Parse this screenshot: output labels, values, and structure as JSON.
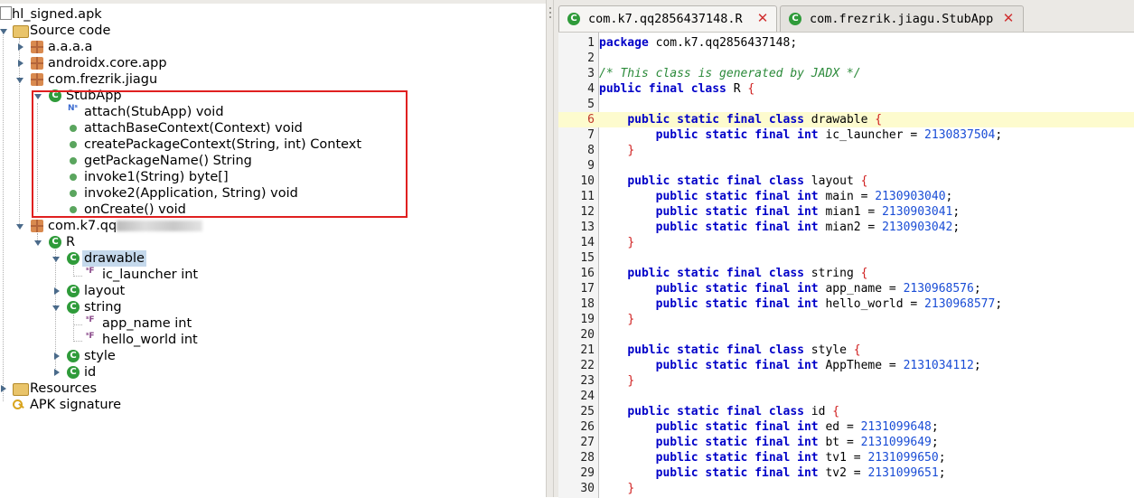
{
  "tree": {
    "root": "hl_signed.apk",
    "source_code": "Source code",
    "packages": [
      "a.a.a.a",
      "androidx.core.app",
      "com.frezrik.jiagu"
    ],
    "stubapp": "StubApp",
    "methods": [
      {
        "label": "attach(StubApp) void",
        "icon": "static-method-icon"
      },
      {
        "label": "attachBaseContext(Context) void",
        "icon": "method-icon"
      },
      {
        "label": "createPackageContext(String, int) Context",
        "icon": "method-icon"
      },
      {
        "label": "getPackageName() String",
        "icon": "method-icon"
      },
      {
        "label": "invoke1(String) byte[]",
        "icon": "method-icon"
      },
      {
        "label": "invoke2(Application, String) void",
        "icon": "method-icon"
      },
      {
        "label": "onCreate() void",
        "icon": "method-icon"
      }
    ],
    "pkg_k7_prefix": "com.k7.qq",
    "class_r": "R",
    "inner_classes": {
      "drawable": "drawable",
      "drawable_fields": [
        "ic_launcher int"
      ],
      "layout": "layout",
      "string": "string",
      "string_fields": [
        "app_name int",
        "hello_world int"
      ],
      "style": "style",
      "id": "id"
    },
    "resources": "Resources",
    "apk_signature": "APK signature"
  },
  "tabs": [
    {
      "label": "com.k7.qq2856437148.R",
      "active": true
    },
    {
      "label": "com.frezrik.jiagu.StubApp",
      "active": false
    }
  ],
  "editor": {
    "current_line": 6,
    "lines": [
      {
        "n": "1",
        "parts": [
          [
            "kw",
            "package"
          ],
          [
            "t",
            " com.k7.qq2856437148;"
          ]
        ]
      },
      {
        "n": "2",
        "parts": []
      },
      {
        "n": "3",
        "parts": [
          [
            "cm",
            "/* This class is generated by JADX */"
          ]
        ]
      },
      {
        "n": "4",
        "parts": [
          [
            "kw",
            "public final class"
          ],
          [
            "t",
            " R "
          ],
          [
            "b",
            "{"
          ]
        ]
      },
      {
        "n": "5",
        "parts": []
      },
      {
        "n": "6",
        "parts": [
          [
            "t",
            "    "
          ],
          [
            "kw",
            "public static final class"
          ],
          [
            "t",
            " drawable "
          ],
          [
            "b",
            "{"
          ]
        ]
      },
      {
        "n": "7",
        "parts": [
          [
            "t",
            "        "
          ],
          [
            "kw",
            "public static final int"
          ],
          [
            "t",
            " ic_launcher = "
          ],
          [
            "num",
            "2130837504"
          ],
          [
            "t",
            ";"
          ]
        ]
      },
      {
        "n": "8",
        "parts": [
          [
            "t",
            "    "
          ],
          [
            "b",
            "}"
          ]
        ]
      },
      {
        "n": "9",
        "parts": []
      },
      {
        "n": "10",
        "parts": [
          [
            "t",
            "    "
          ],
          [
            "kw",
            "public static final class"
          ],
          [
            "t",
            " layout "
          ],
          [
            "b",
            "{"
          ]
        ]
      },
      {
        "n": "11",
        "parts": [
          [
            "t",
            "        "
          ],
          [
            "kw",
            "public static final int"
          ],
          [
            "t",
            " main = "
          ],
          [
            "num",
            "2130903040"
          ],
          [
            "t",
            ";"
          ]
        ]
      },
      {
        "n": "12",
        "parts": [
          [
            "t",
            "        "
          ],
          [
            "kw",
            "public static final int"
          ],
          [
            "t",
            " mian1 = "
          ],
          [
            "num",
            "2130903041"
          ],
          [
            "t",
            ";"
          ]
        ]
      },
      {
        "n": "13",
        "parts": [
          [
            "t",
            "        "
          ],
          [
            "kw",
            "public static final int"
          ],
          [
            "t",
            " mian2 = "
          ],
          [
            "num",
            "2130903042"
          ],
          [
            "t",
            ";"
          ]
        ]
      },
      {
        "n": "14",
        "parts": [
          [
            "t",
            "    "
          ],
          [
            "b",
            "}"
          ]
        ]
      },
      {
        "n": "15",
        "parts": []
      },
      {
        "n": "16",
        "parts": [
          [
            "t",
            "    "
          ],
          [
            "kw",
            "public static final class"
          ],
          [
            "t",
            " string "
          ],
          [
            "b",
            "{"
          ]
        ]
      },
      {
        "n": "17",
        "parts": [
          [
            "t",
            "        "
          ],
          [
            "kw",
            "public static final int"
          ],
          [
            "t",
            " app_name = "
          ],
          [
            "num",
            "2130968576"
          ],
          [
            "t",
            ";"
          ]
        ]
      },
      {
        "n": "18",
        "parts": [
          [
            "t",
            "        "
          ],
          [
            "kw",
            "public static final int"
          ],
          [
            "t",
            " hello_world = "
          ],
          [
            "num",
            "2130968577"
          ],
          [
            "t",
            ";"
          ]
        ]
      },
      {
        "n": "19",
        "parts": [
          [
            "t",
            "    "
          ],
          [
            "b",
            "}"
          ]
        ]
      },
      {
        "n": "20",
        "parts": []
      },
      {
        "n": "21",
        "parts": [
          [
            "t",
            "    "
          ],
          [
            "kw",
            "public static final class"
          ],
          [
            "t",
            " style "
          ],
          [
            "b",
            "{"
          ]
        ]
      },
      {
        "n": "22",
        "parts": [
          [
            "t",
            "        "
          ],
          [
            "kw",
            "public static final int"
          ],
          [
            "t",
            " AppTheme = "
          ],
          [
            "num",
            "2131034112"
          ],
          [
            "t",
            ";"
          ]
        ]
      },
      {
        "n": "23",
        "parts": [
          [
            "t",
            "    "
          ],
          [
            "b",
            "}"
          ]
        ]
      },
      {
        "n": "24",
        "parts": []
      },
      {
        "n": "25",
        "parts": [
          [
            "t",
            "    "
          ],
          [
            "kw",
            "public static final class"
          ],
          [
            "t",
            " id "
          ],
          [
            "b",
            "{"
          ]
        ]
      },
      {
        "n": "26",
        "parts": [
          [
            "t",
            "        "
          ],
          [
            "kw",
            "public static final int"
          ],
          [
            "t",
            " ed = "
          ],
          [
            "num",
            "2131099648"
          ],
          [
            "t",
            ";"
          ]
        ]
      },
      {
        "n": "27",
        "parts": [
          [
            "t",
            "        "
          ],
          [
            "kw",
            "public static final int"
          ],
          [
            "t",
            " bt = "
          ],
          [
            "num",
            "2131099649"
          ],
          [
            "t",
            ";"
          ]
        ]
      },
      {
        "n": "28",
        "parts": [
          [
            "t",
            "        "
          ],
          [
            "kw",
            "public static final int"
          ],
          [
            "t",
            " tv1 = "
          ],
          [
            "num",
            "2131099650"
          ],
          [
            "t",
            ";"
          ]
        ]
      },
      {
        "n": "29",
        "parts": [
          [
            "t",
            "        "
          ],
          [
            "kw",
            "public static final int"
          ],
          [
            "t",
            " tv2 = "
          ],
          [
            "num",
            "2131099651"
          ],
          [
            "t",
            ";"
          ]
        ]
      },
      {
        "n": "30",
        "parts": [
          [
            "t",
            "    "
          ],
          [
            "b",
            "}"
          ]
        ]
      }
    ]
  },
  "colors": {
    "keyword": "#0000c8",
    "comment": "#2b8a3a",
    "number": "#1a4dd6",
    "brace": "#d02020",
    "current_line_bg": "#fdfbce",
    "annotation_box": "#e02020",
    "selection": "#c5d9ec"
  }
}
